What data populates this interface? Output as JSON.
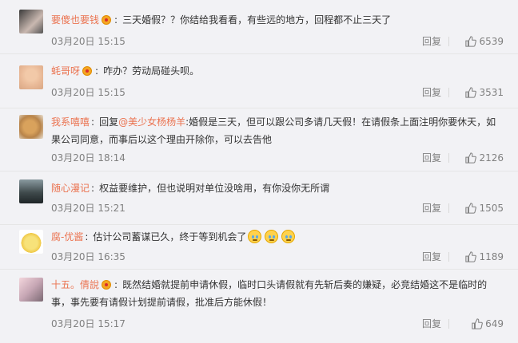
{
  "comments": [
    {
      "username": "要傻也要钱",
      "text": "三天婚假？？你结给我看看，有些远的地方，回程都不止三天了",
      "time": "03月20日 15:15",
      "reply_label": "回复",
      "likes": "6539"
    },
    {
      "username": "蚝哥呀",
      "text": "咋办？劳动局碰头呗。",
      "time": "03月20日 15:15",
      "reply_label": "回复",
      "likes": "3531"
    },
    {
      "username": "我系嘻嘻",
      "reply_prefix": "回复",
      "mention": "@美少女杨杨羊",
      "text": ":婚假是三天，但可以跟公司多请几天假！在请假条上面注明你要休天，如果公司同意，而事后以这个理由开除你，可以去告他",
      "time": "03月20日 18:14",
      "reply_label": "回复",
      "likes": "2126"
    },
    {
      "username": "随心漫记",
      "text": "权益要维护，但也说明对单位没啥用，有你没你无所谓",
      "time": "03月20日 15:21",
      "reply_label": "回复",
      "likes": "1505"
    },
    {
      "username": "腐-优酱",
      "text": "估计公司蓄谋已久，终于等到机会了",
      "time": "03月20日 16:35",
      "reply_label": "回复",
      "likes": "1189"
    },
    {
      "username": "十五。倩說",
      "text": "既然结婚就提前申请休假，临时口头请假就有先斩后奏的嫌疑，必竞结婚这不是临时的事，事先要有请假计划提前请假，批准后方能休假！",
      "time": "03月20日 15:17",
      "reply_label": "回复",
      "likes": "649"
    }
  ]
}
